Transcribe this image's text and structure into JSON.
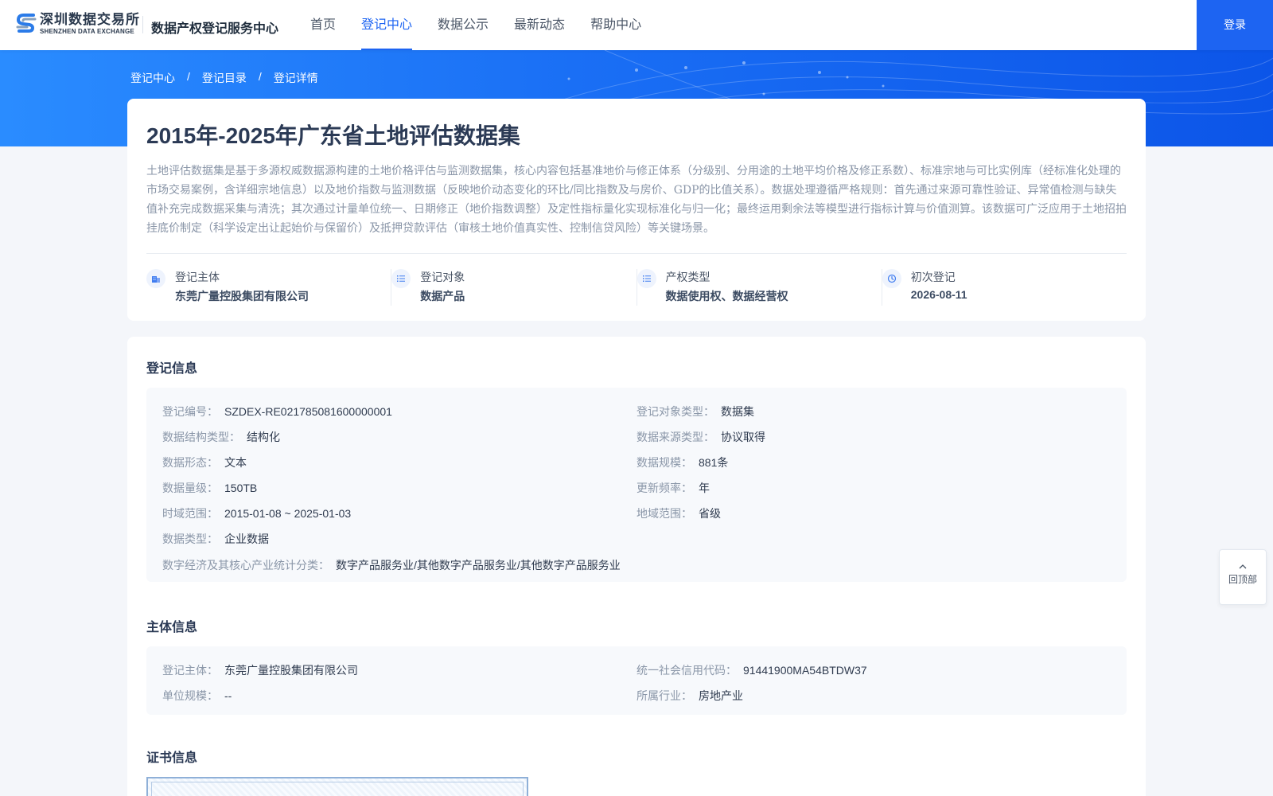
{
  "header": {
    "logo_cn": "深圳数据交易所",
    "logo_en": "SHENZHEN DATA EXCHANGE",
    "site_title": "数据产权登记服务中心",
    "nav": [
      "首页",
      "登记中心",
      "数据公示",
      "最新动态",
      "帮助中心"
    ],
    "active_nav": "登记中心",
    "login_label": "登录"
  },
  "breadcrumb": [
    "登记中心",
    "登记目录",
    "登记详情"
  ],
  "breadcrumb_sep": "/",
  "dataset": {
    "title": "2015年-2025年广东省土地评估数据集",
    "description": "土地评估数据集是基于多源权威数据源构建的土地价格评估与监测数据集，核心内容包括基准地价与修正体系（分级别、分用途的土地平均价格及修正系数）、标准宗地与可比实例库（经标准化处理的市场交易案例，含详细宗地信息）以及地价指数与监测数据（反映地价动态变化的环比/同比指数及与房价、GDP的比值关系）。数据处理遵循严格规则：首先通过来源可靠性验证、异常值检测与缺失值补充完成数据采集与清洗；其次通过计量单位统一、日期修正（地价指数调整）及定性指标量化实现标准化与归一化；最终运用剩余法等模型进行指标计算与价值测算。该数据可广泛应用于土地招拍挂底价制定（科学设定出让起始价与保留价）及抵押贷款评估（审核土地价值真实性、控制信贷风险）等关键场景。"
  },
  "summary": [
    {
      "icon": "building-icon",
      "label": "登记主体",
      "value": "东莞广量控股集团有限公司"
    },
    {
      "icon": "list-icon",
      "label": "登记对象",
      "value": "数据产品"
    },
    {
      "icon": "list-icon",
      "label": "产权类型",
      "value": "数据使用权、数据经营权"
    },
    {
      "icon": "clock-icon",
      "label": "初次登记",
      "value": "2026-08-11"
    }
  ],
  "registration": {
    "title": "登记信息",
    "rows": [
      {
        "k": "登记编号：",
        "v": "SZDEX-RE021785081600000001"
      },
      {
        "k": "登记对象类型：",
        "v": "数据集"
      },
      {
        "k": "数据结构类型：",
        "v": "结构化"
      },
      {
        "k": "数据来源类型：",
        "v": "协议取得"
      },
      {
        "k": "数据形态：",
        "v": "文本"
      },
      {
        "k": "数据规模：",
        "v": "881条"
      },
      {
        "k": "数据量级：",
        "v": "150TB"
      },
      {
        "k": "更新频率：",
        "v": "年"
      },
      {
        "k": "时域范围：",
        "v": "2015-01-08 ~ 2025-01-03"
      },
      {
        "k": "地域范围：",
        "v": "省级"
      },
      {
        "k": "数据类型：",
        "v": "企业数据"
      },
      {
        "k": "数字经济及其核心产业统计分类：",
        "v": "数字产品服务业/其他数字产品服务业/其他数字产品服务业"
      }
    ]
  },
  "entity": {
    "title": "主体信息",
    "rows": [
      {
        "k": "登记主体：",
        "v": "东莞广量控股集团有限公司"
      },
      {
        "k": "统一社会信用代码：",
        "v": "91441900MA54BTDW37"
      },
      {
        "k": "单位规模：",
        "v": "--"
      },
      {
        "k": "所属行业：",
        "v": "房地产业"
      }
    ]
  },
  "certificate": {
    "title": "证书信息"
  },
  "back_to_top": "回顶部",
  "colors": {
    "primary": "#1d64f2",
    "banner_start": "#2a8cff",
    "banner_end": "#0c55e8"
  }
}
